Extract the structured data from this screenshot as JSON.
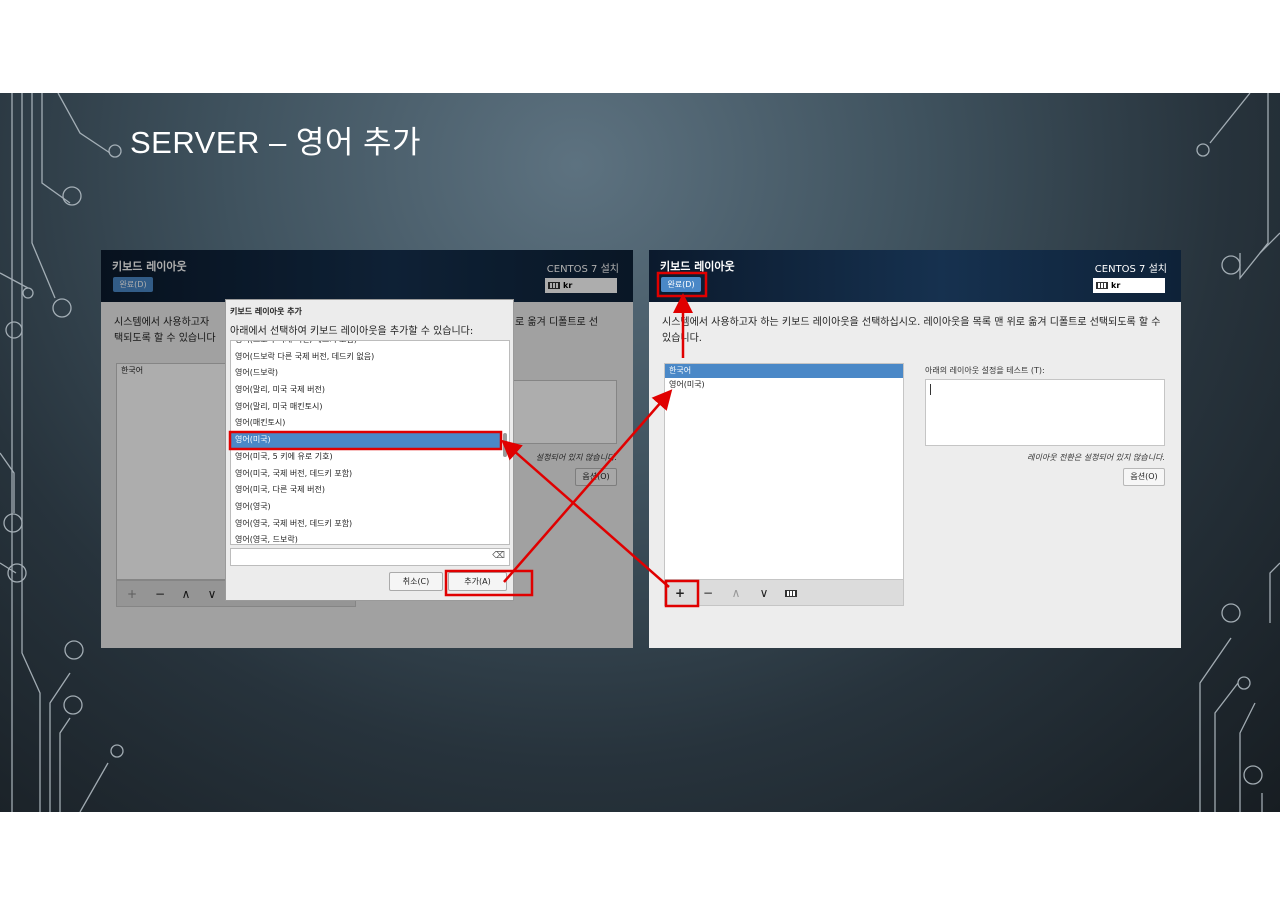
{
  "slide": {
    "title": "SERVER – 영어 추가"
  },
  "installer": {
    "header_title": "키보드 레이아웃",
    "done_button": "완료(D)",
    "os_title": "CENTOS 7 설치",
    "keyboard_indicator": "kr",
    "description": "시스템에서 사용하고자 하는 키보드 레이아웃을 선택하십시오. 레이아웃을 목록 맨 위로 옮겨 디폴트로 선택되도록 할 수 있습니다.",
    "test_label": "아래의 레이아웃 설정을 테스트 (T):",
    "switch_note": "레이아웃 전환은 설정되어 있지 않습니다.",
    "options_button": "옵션(O)",
    "toolbar": {
      "add": "+",
      "remove": "−",
      "up": "∧",
      "down": "∨"
    }
  },
  "left_screen": {
    "desc_visible_1": "시스템에서 사용하고자",
    "desc_visible_2": "택되도록 할 수 있습니다",
    "desc_right": "로 옮겨 디폴트로 선",
    "layouts": [
      "한국어"
    ],
    "switch_note_partial": "설정되어 있지 않습니다.",
    "options_button_partial": "옵션(O)"
  },
  "right_screen": {
    "layouts": [
      "한국어",
      "영어(미국)"
    ]
  },
  "dialog": {
    "title": "키보드 레이아웃 추가",
    "subtitle": "아래에서 선택하여 키보드 레이아웃을 추가할 수 있습니다:",
    "items": [
      "영어(드보락 국제 버전, 데드키 포함)",
      "영어(드보락 다른 국제 버전, 데드키 없음)",
      "영어(드보락)",
      "영어(말리, 미국 국제 버전)",
      "영어(말리, 미국 매킨토시)",
      "영어(매킨토시)",
      "영어(미국)",
      "영어(미국, 5 키에 유로 기호)",
      "영어(미국, 국제 버전, 데드키 포함)",
      "영어(미국, 다른 국제 버전)",
      "영어(영국)",
      "영어(영국, 국제 버전, 데드키 포함)",
      "영어(영국, 드보락)"
    ],
    "selected_index": 6,
    "cancel_button": "취소(C)",
    "add_button": "추가(A)"
  },
  "colors": {
    "accent": "#4a88c7",
    "annotation": "#e00000",
    "header": "#0f2540"
  }
}
